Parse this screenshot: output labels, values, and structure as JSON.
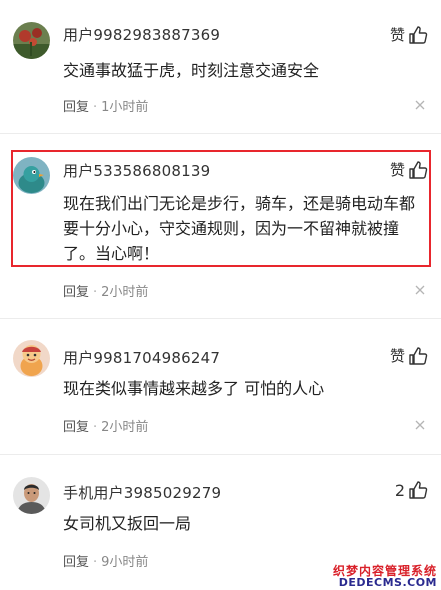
{
  "comments": [
    {
      "username": "用户9982983887369",
      "like_label": "赞",
      "content": "交通事故猛于虎，时刻注意交通安全",
      "reply_label": "回复",
      "separator": "·",
      "time": "1小时前",
      "avatar_icon": "plant-avatar-icon"
    },
    {
      "username": "用户533586808139",
      "like_label": "赞",
      "content": "现在我们出门无论是步行，骑车，还是骑电动车都要十分小心，守交通规则，因为一不留神就被撞了。当心啊！",
      "reply_label": "回复",
      "separator": "·",
      "time": "2小时前",
      "avatar_icon": "bird-avatar-icon"
    },
    {
      "username": "用户9981704986247",
      "like_label": "赞",
      "content": "现在类似事情越来越多了 可怕的人心",
      "reply_label": "回复",
      "separator": "·",
      "time": "2小时前",
      "avatar_icon": "cartoon-avatar-icon"
    },
    {
      "username": "手机用户3985029279",
      "like_label": "2",
      "content": "女司机又扳回一局",
      "reply_label": "回复",
      "separator": "·",
      "time": "9小时前",
      "avatar_icon": "person-avatar-icon"
    }
  ],
  "watermark": {
    "line1": "织梦内容管理系统",
    "line2": "DEDECMS.COM"
  },
  "colors": {
    "highlight": "#e8262d",
    "meta": "#888888",
    "text": "#222222"
  }
}
